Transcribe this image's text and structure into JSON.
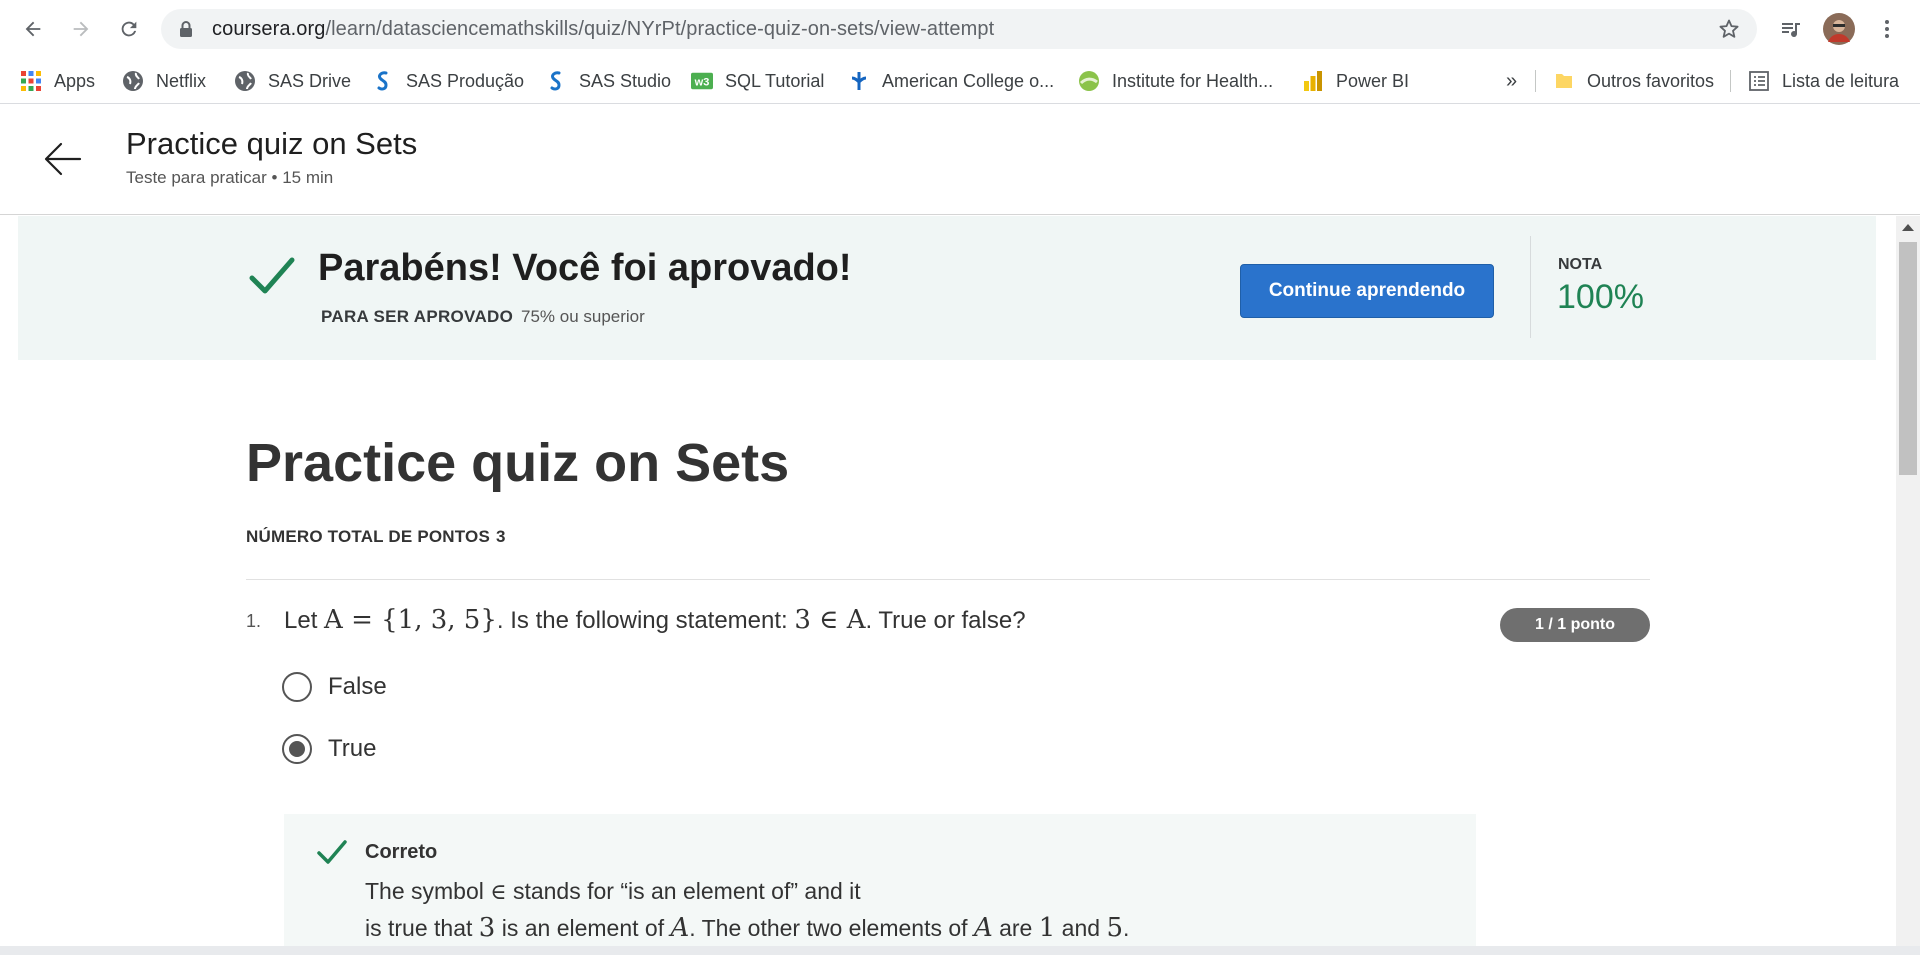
{
  "browser": {
    "url_host": "coursera.org",
    "url_path": "/learn/datasciencemathskills/quiz/NYrPt/practice-quiz-on-sets/view-attempt"
  },
  "bookmarks": [
    {
      "label": "Apps",
      "icon": "apps-grid-icon"
    },
    {
      "label": "Netflix",
      "icon": "globe-icon"
    },
    {
      "label": "SAS Drive",
      "icon": "globe-icon"
    },
    {
      "label": "SAS Produção",
      "icon": "sas-logo-icon"
    },
    {
      "label": "SAS Studio",
      "icon": "sas-logo-icon"
    },
    {
      "label": "SQL Tutorial",
      "icon": "w3schools-icon"
    },
    {
      "label": "American College o...",
      "icon": "acm-icon"
    },
    {
      "label": "Institute for Health...",
      "icon": "ihme-icon"
    },
    {
      "label": "Power BI",
      "icon": "powerbi-icon"
    }
  ],
  "bookmarks_overflow": "»",
  "other_bookmarks": "Outros favoritos",
  "reading_list": "Lista de leitura",
  "header": {
    "title": "Practice quiz on Sets",
    "subtitle": "Teste para praticar • 15 min"
  },
  "banner": {
    "message": "Parabéns! Você foi aprovado!",
    "pass_label": "PARA SER APROVADO",
    "pass_value": "75% ou superior",
    "continue_label": "Continue aprendendo",
    "grade_label": "NOTA",
    "grade_value": "100%"
  },
  "quiz": {
    "title": "Practice quiz on Sets",
    "total_points_label": "NÚMERO TOTAL DE PONTOS",
    "total_points_value": "3",
    "questions": [
      {
        "number": "1.",
        "text_before": "Let ",
        "set_math": "A = {1, 3, 5}",
        "text_middle": ". Is the following statement: ",
        "statement_math": "3 ∈ A",
        "text_after": ".  True or false?",
        "points": "1 / 1 ponto",
        "options": [
          {
            "label": "False",
            "selected": false
          },
          {
            "label": "True",
            "selected": true
          }
        ],
        "feedback": {
          "title": "Correto",
          "line1_pre": "The symbol ",
          "line1_sym": "∈",
          "line1_post": " stands for “is an element of” and it",
          "line2_a": "is true that ",
          "line2_b": "3",
          "line2_c": " is an element of ",
          "line2_d": "A",
          "line2_e": ". The other two elements of ",
          "line2_f": "A",
          "line2_g": " are ",
          "line2_h": "1",
          "line2_i": " and ",
          "line2_j": "5",
          "line2_k": "."
        }
      }
    ]
  },
  "colors": {
    "accent_blue": "#2a73cc",
    "success_green": "#1f8354",
    "banner_bg": "#f0f6f5"
  }
}
